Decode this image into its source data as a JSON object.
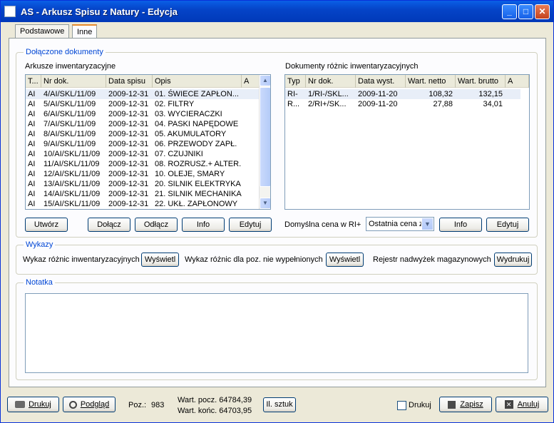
{
  "window": {
    "title": "AS - Arkusz Spisu z Natury - Edycja",
    "controls": {
      "minimize": "_",
      "maximize": "□",
      "close": "✕"
    }
  },
  "tabs": [
    {
      "label": "Podstawowe"
    },
    {
      "label": "Inne"
    }
  ],
  "attached": {
    "group_label": "Dołączone dokumenty",
    "sheets": {
      "label": "Arkusze inwentaryzacyjne",
      "columns": [
        "T...",
        "Nr dok.",
        "Data spisu",
        "Opis",
        "A"
      ],
      "rows": [
        [
          "AI",
          "4/AI/SKL/11/09",
          "2009-12-31",
          "01. ŚWIECE ZAPŁON...",
          ""
        ],
        [
          "AI",
          "5/AI/SKL/11/09",
          "2009-12-31",
          "02. FILTRY",
          ""
        ],
        [
          "AI",
          "6/AI/SKL/11/09",
          "2009-12-31",
          "03. WYCIERACZKI",
          ""
        ],
        [
          "AI",
          "7/AI/SKL/11/09",
          "2009-12-31",
          "04. PASKI NAPĘDOWE",
          ""
        ],
        [
          "AI",
          "8/AI/SKL/11/09",
          "2009-12-31",
          "05. AKUMULATORY",
          ""
        ],
        [
          "AI",
          "9/AI/SKL/11/09",
          "2009-12-31",
          "06. PRZEWODY ZAPŁ.",
          ""
        ],
        [
          "AI",
          "10/AI/SKL/11/09",
          "2009-12-31",
          "07. CZUJNIKI",
          ""
        ],
        [
          "AI",
          "11/AI/SKL/11/09",
          "2009-12-31",
          "08. ROZRUSZ.+ ALTER.",
          ""
        ],
        [
          "AI",
          "12/AI/SKL/11/09",
          "2009-12-31",
          "10. OLEJE, SMARY",
          ""
        ],
        [
          "AI",
          "13/AI/SKL/11/09",
          "2009-12-31",
          "20. SILNIK ELEKTRYKA",
          ""
        ],
        [
          "AI",
          "14/AI/SKL/11/09",
          "2009-12-31",
          "21. SILNIK MECHANIKA",
          ""
        ],
        [
          "AI",
          "15/AI/SKL/11/09",
          "2009-12-31",
          "22. UKŁ. ZAPŁONOWY",
          ""
        ]
      ],
      "buttons": {
        "create": "Utwórz",
        "attach": "Dołącz",
        "detach": "Odłącz",
        "info": "Info",
        "edit": "Edytuj"
      }
    },
    "diffs": {
      "label": "Dokumenty różnic inwentaryzacyjnych",
      "columns": [
        "Typ",
        "Nr dok.",
        "Data wyst.",
        "Wart. netto",
        "Wart. brutto",
        "A"
      ],
      "rows": [
        [
          "RI-",
          "1/RI-/SKL...",
          "2009-11-20",
          "108,32",
          "132,15",
          ""
        ],
        [
          "R...",
          "2/RI+/SK...",
          "2009-11-20",
          "27,88",
          "34,01",
          ""
        ]
      ],
      "price_label": "Domyślna cena w RI+",
      "price_value": "Ostatnia cena z",
      "buttons": {
        "info": "Info",
        "edit": "Edytuj"
      }
    }
  },
  "reports": {
    "group_label": "Wykazy",
    "diff_label": "Wykaz różnic inwentaryzacyjnych",
    "diff_button": "Wyświetl",
    "unfilled_label": "Wykaz różnic dla poz. nie wypełnionych",
    "unfilled_button": "Wyświetl",
    "surplus_label": "Rejestr nadwyżek magazynowych",
    "surplus_button": "Wydrukuj"
  },
  "note": {
    "group_label": "Notatka",
    "value": ""
  },
  "footer": {
    "print_label": "Drukuj",
    "preview_label": "Podgląd",
    "poz_label": "Poz.:",
    "poz_value": "983",
    "start_value": "Wart. pocz. 64784,39",
    "end_value": "Wart. końc. 64703,95",
    "qty_button": "Il. sztuk",
    "print_check_label": "Drukuj",
    "save_label": "Zapisz",
    "cancel_label": "Anuluj"
  }
}
